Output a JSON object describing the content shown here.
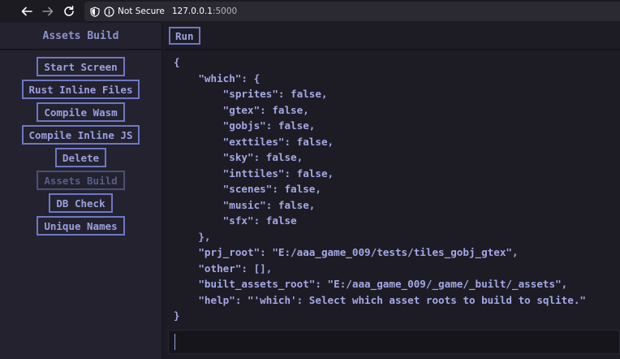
{
  "browser": {
    "security_label": "Not Secure",
    "url_host": "127.0.0.1",
    "url_port": ":5000"
  },
  "sidebar": {
    "title": "Assets Build",
    "items": [
      {
        "label": "Start Screen"
      },
      {
        "label": "Rust Inline Files"
      },
      {
        "label": "Compile Wasm"
      },
      {
        "label": "Compile Inline JS"
      },
      {
        "label": "Delete"
      },
      {
        "label": "Assets Build",
        "active": true
      },
      {
        "label": "DB Check"
      },
      {
        "label": "Unique Names"
      }
    ]
  },
  "toolbar": {
    "run_label": "Run"
  },
  "editor": {
    "lines": [
      "{",
      "    \"which\": {",
      "        \"sprites\": false,",
      "        \"gtex\": false,",
      "        \"gobjs\": false,",
      "        \"exttiles\": false,",
      "        \"sky\": false,",
      "        \"inttiles\": false,",
      "        \"scenes\": false,",
      "        \"music\": false,",
      "        \"sfx\": false",
      "    },",
      "    \"prj_root\": \"E:/aaa_game_009/tests/tiles_gobj_gtex\",",
      "    \"other\": [],",
      "    \"built_assets_root\": \"E:/aaa_game_009/_game/_built/_assets\",",
      "    \"help\": \"'which': Select which asset roots to build to sqlite.\"",
      "}"
    ]
  },
  "console": {
    "value": ""
  }
}
